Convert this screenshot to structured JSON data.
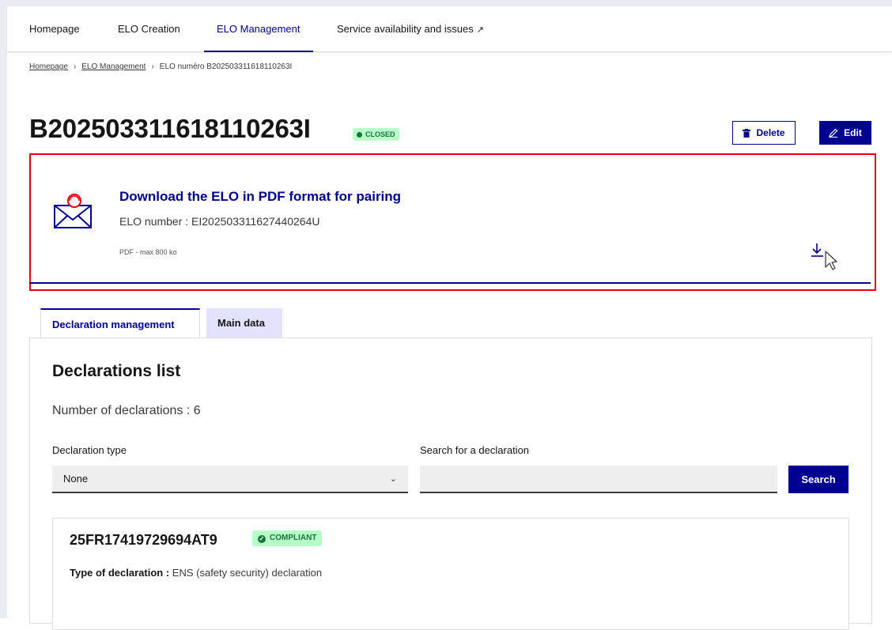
{
  "nav": {
    "items": [
      {
        "label": "Homepage"
      },
      {
        "label": "ELO Creation"
      },
      {
        "label": "ELO Management"
      },
      {
        "label": "Service availability and issues"
      }
    ],
    "active_index": 2
  },
  "breadcrumb": {
    "items": [
      "Homepage",
      "ELO Management",
      "ELO numéro B20250331161811026​3I"
    ]
  },
  "header": {
    "title": "B202503311618110263I",
    "status_badge": "CLOSED",
    "delete_label": "Delete",
    "edit_label": "Edit"
  },
  "download": {
    "title": "Download the ELO in PDF format for pairing",
    "number_label": "ELO number : EI202503311627440264U",
    "meta": "PDF - max 800 ko"
  },
  "tabs": [
    {
      "label": "Declaration management",
      "active": true
    },
    {
      "label": "Main data",
      "active": false
    }
  ],
  "declarations": {
    "heading": "Declarations list",
    "count_label": "Number of declarations : 6",
    "type_label": "Declaration type",
    "type_value": "None",
    "search_label": "Search for a declaration",
    "search_placeholder": "",
    "search_button": "Search",
    "items": [
      {
        "id": "25FR17419729694AT9",
        "status": "COMPLIANT",
        "type_key": "Type of declaration :",
        "type_value": "ENS (safety security) declaration"
      }
    ]
  },
  "colors": {
    "primary": "#000091",
    "highlight_border": "#e1000f",
    "success_bg": "#b8fec9",
    "success_text": "#18753c"
  }
}
